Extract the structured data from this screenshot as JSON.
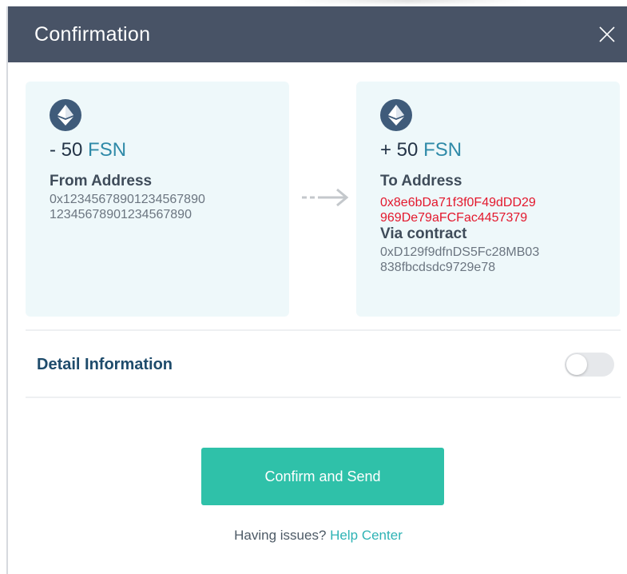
{
  "header": {
    "title": "Confirmation",
    "close_icon": "close-icon"
  },
  "from_card": {
    "icon": "ethereum-icon",
    "amount_prefix": "- 50",
    "unit": "FSN",
    "label": "From Address",
    "address_line1": "0x12345678901234567890",
    "address_line2": "12345678901234567890"
  },
  "arrow_icon": "dashed-arrow-right-icon",
  "to_card": {
    "icon": "ethereum-icon",
    "amount_prefix": "+ 50",
    "unit": "FSN",
    "label": "To Address",
    "address_line1": "0x8e6bDa71f3f0F49dDD29",
    "address_line2": "969De79aFCFac4457379",
    "via_label": "Via contract",
    "contract_line1": "0xD129f9dfnDS5Fc28MB03",
    "contract_line2": "838fbcdsdc9729e78"
  },
  "detail": {
    "label": "Detail Information",
    "toggle_on": false
  },
  "confirm_button": "Confirm and Send",
  "help": {
    "text": "Having issues?",
    "link": "Help Center"
  },
  "colors": {
    "header_bg": "#485366",
    "card_bg": "#eef8fa",
    "accent": "#2fc1a9",
    "red_address": "#e3182d"
  }
}
